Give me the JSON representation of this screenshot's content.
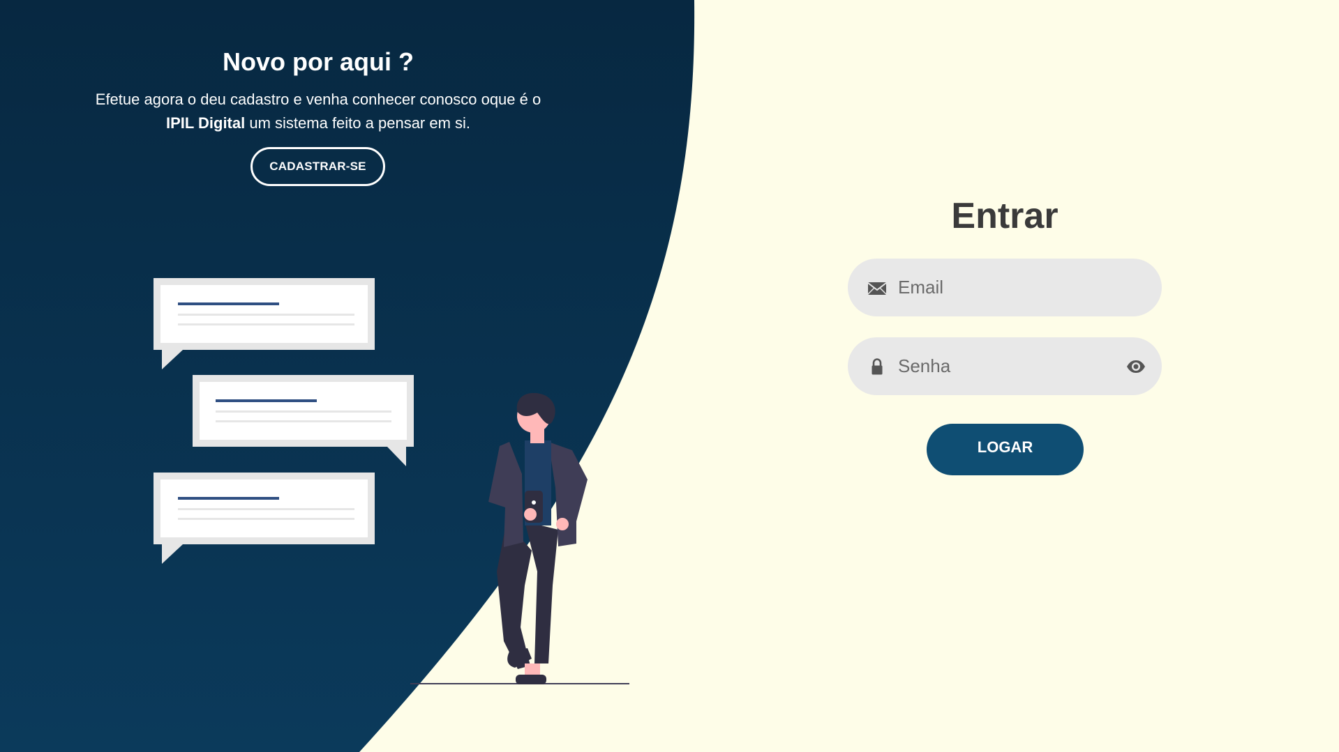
{
  "colors": {
    "left_panel_top": "#082840",
    "left_panel_bottom": "#0a3352",
    "page_background": "#fefde8",
    "field_background": "#e8e8e8",
    "login_button": "#0f4e73",
    "title_dark": "#3a3a3a"
  },
  "signup_panel": {
    "title": "Novo por aqui ?",
    "text_before": "Efetue agora o deu cadastro e venha conhecer conosco oque é o",
    "brand": "IPIL Digital",
    "text_after": "um sistema feito a pensar em si.",
    "button_label": "CADASTRAR-SE"
  },
  "login_form": {
    "title": "Entrar",
    "email": {
      "placeholder": "Email",
      "value": "",
      "icon": "envelope-icon"
    },
    "password": {
      "placeholder": "Senha",
      "value": "",
      "icon": "lock-icon",
      "toggle_icon": "eye-icon"
    },
    "submit_label": "LOGAR"
  },
  "illustration": {
    "subject": "person-with-phone",
    "chat_bubbles": 3
  }
}
